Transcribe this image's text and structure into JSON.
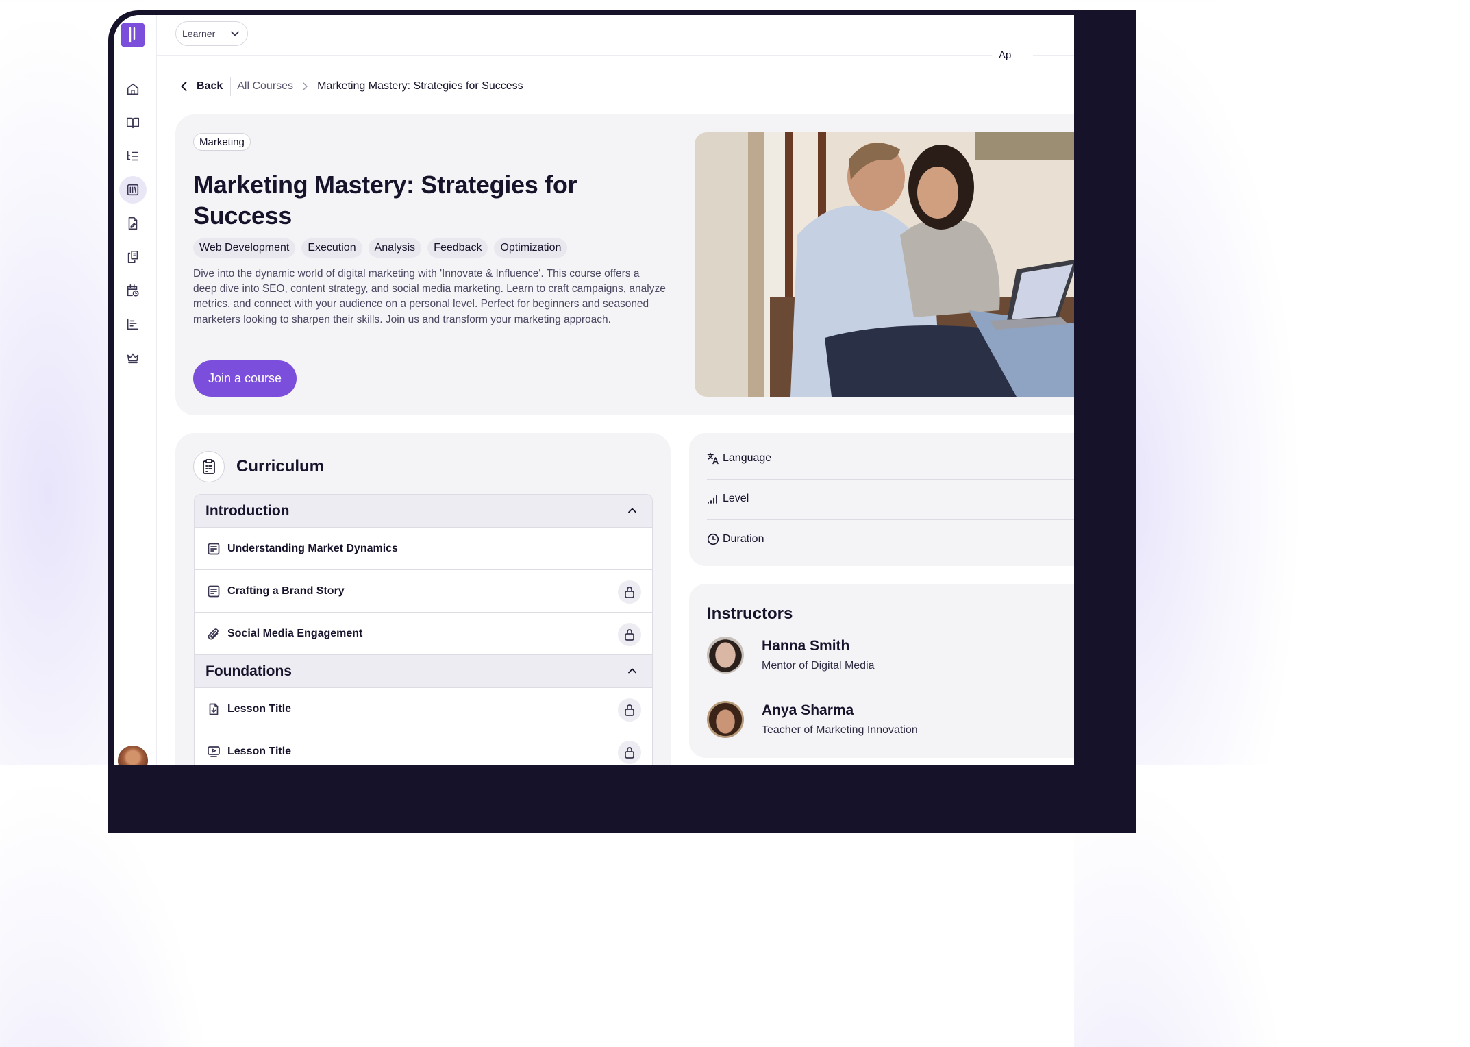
{
  "app": {
    "role_selector": {
      "value": "Learner"
    },
    "sidebar": {
      "items": [
        {
          "icon": "home-icon",
          "label": "Home"
        },
        {
          "icon": "book-icon",
          "label": "Courses"
        },
        {
          "icon": "list-icon",
          "label": "Curriculum"
        },
        {
          "icon": "library-icon",
          "label": "Library",
          "active": true
        },
        {
          "icon": "file-edit-icon",
          "label": "Assignments"
        },
        {
          "icon": "documents-icon",
          "label": "Documents"
        },
        {
          "icon": "calendar-clock-icon",
          "label": "Schedule"
        },
        {
          "icon": "bar-chart-icon",
          "label": "Reports"
        },
        {
          "icon": "crown-icon",
          "label": "Leaderboard"
        }
      ]
    },
    "accent_color": "#7b4fdc"
  },
  "breadcrumb": {
    "back_label": "Back",
    "parent_label": "All Courses",
    "current_label": "Marketing Mastery: Strategies for Success"
  },
  "course": {
    "category": "Marketing",
    "title": "Marketing Mastery: Strategies for Success",
    "tags": [
      "Web Development",
      "Execution",
      "Analysis",
      "Feedback",
      "Optimization"
    ],
    "description": "Dive into the dynamic world of digital marketing with 'Innovate & Influence'. This course offers a deep dive into SEO, content strategy, and social media marketing. Learn to craft campaigns, analyze metrics, and connect with your audience on a personal level. Perfect for beginners and seasoned marketers looking to sharpen their skills. Join us and transform your marketing approach.",
    "join_label": "Join a course",
    "photo_badge": "Ap"
  },
  "curriculum": {
    "title": "Curriculum",
    "modules": [
      {
        "title": "Introduction",
        "lessons": [
          {
            "title": "Understanding Market Dynamics",
            "icon": "document-icon",
            "locked": false
          },
          {
            "title": "Crafting a Brand Story",
            "icon": "document-icon",
            "locked": true
          },
          {
            "title": "Social Media Engagement",
            "icon": "paperclip-icon",
            "locked": true
          }
        ]
      },
      {
        "title": "Foundations",
        "lessons": [
          {
            "title": "Lesson Title",
            "icon": "file-download-icon",
            "locked": true
          },
          {
            "title": "Lesson Title",
            "icon": "video-icon",
            "locked": true
          }
        ]
      }
    ]
  },
  "course_meta": {
    "language_label": "Language",
    "level_label": "Level",
    "duration_label": "Duration"
  },
  "instructors": {
    "title": "Instructors",
    "people": [
      {
        "name": "Hanna Smith",
        "role": "Mentor of Digital Media"
      },
      {
        "name": "Anya Sharma",
        "role": "Teacher of Marketing Innovation"
      }
    ]
  }
}
